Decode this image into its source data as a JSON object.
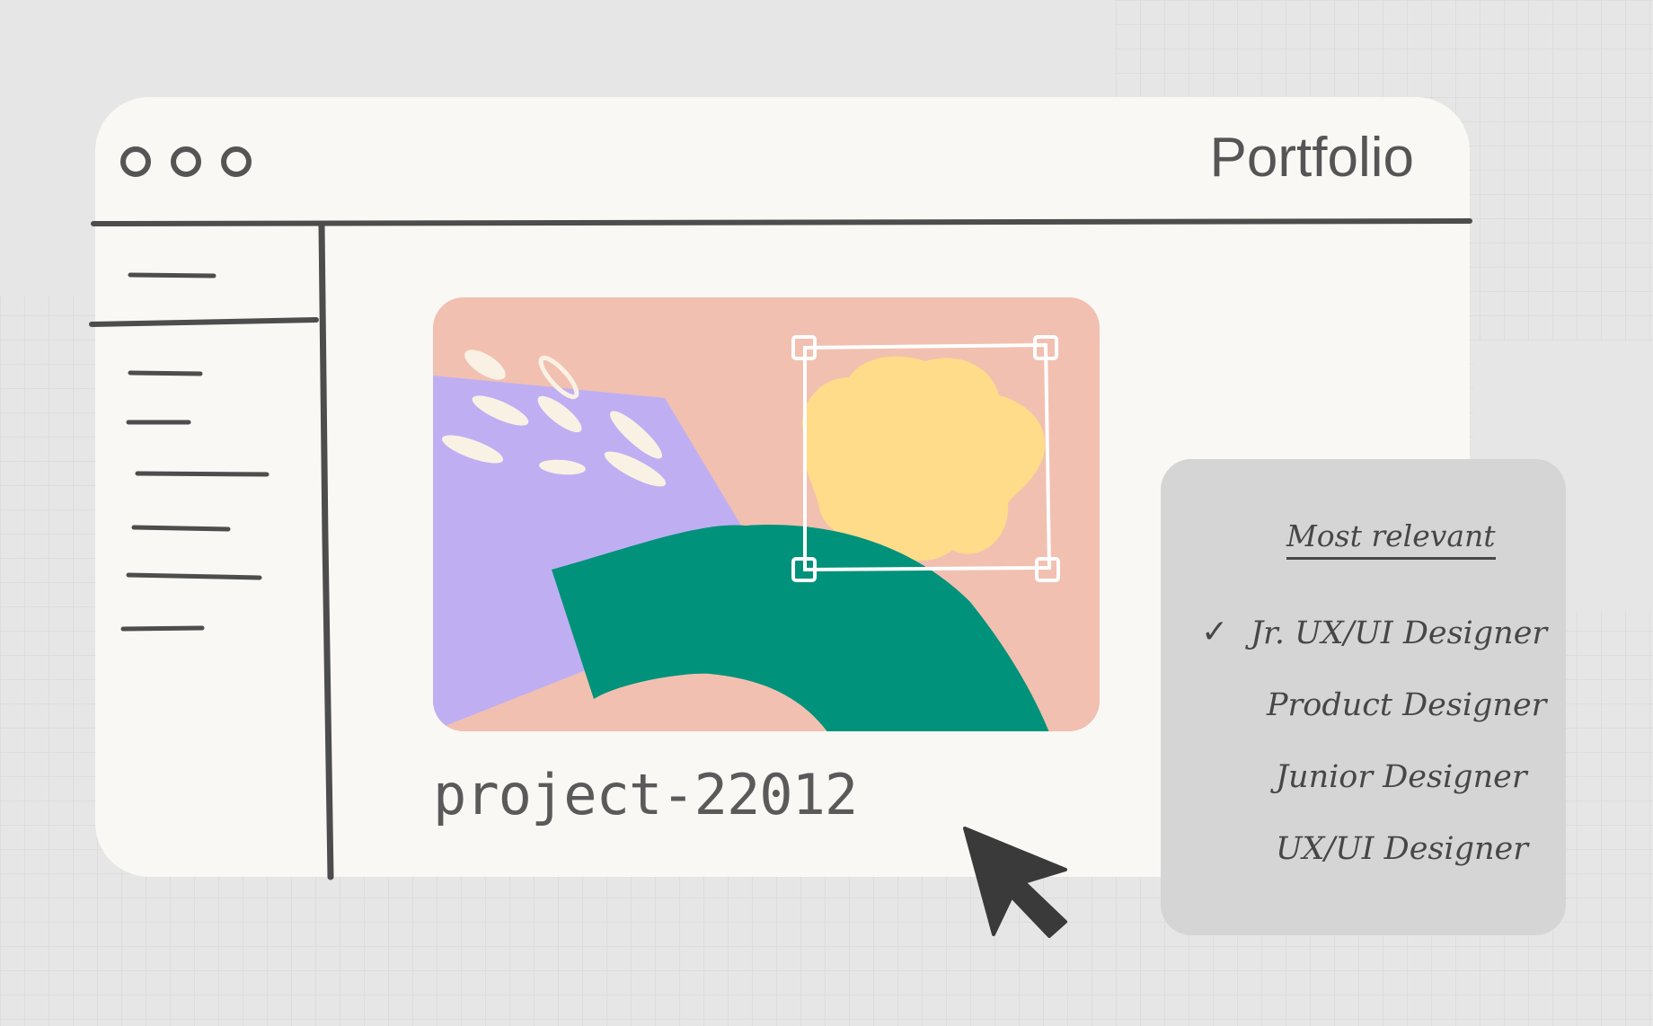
{
  "window": {
    "title": "Portfolio",
    "controls": [
      "dot-1",
      "dot-2",
      "dot-3"
    ]
  },
  "sidebar": {
    "items": [
      "",
      "",
      "",
      "",
      "",
      "",
      ""
    ]
  },
  "artwork": {
    "colors": {
      "background": "#f2c0b0",
      "purple": "#bfaff2",
      "green": "#00927a",
      "yellow": "#fedc8a",
      "cream": "#f9f2e4"
    }
  },
  "project": {
    "filename": "project-22012"
  },
  "dropdown": {
    "header": "Most relevant",
    "items": [
      {
        "label": "Jr. UX/UI Designer",
        "checked": true
      },
      {
        "label": "Product Designer",
        "checked": false
      },
      {
        "label": "Junior Designer",
        "checked": false
      },
      {
        "label": "UX/UI Designer",
        "checked": false
      }
    ],
    "check_glyph": "✓"
  },
  "cursor": {
    "icon": "pointer-arrow-icon"
  }
}
